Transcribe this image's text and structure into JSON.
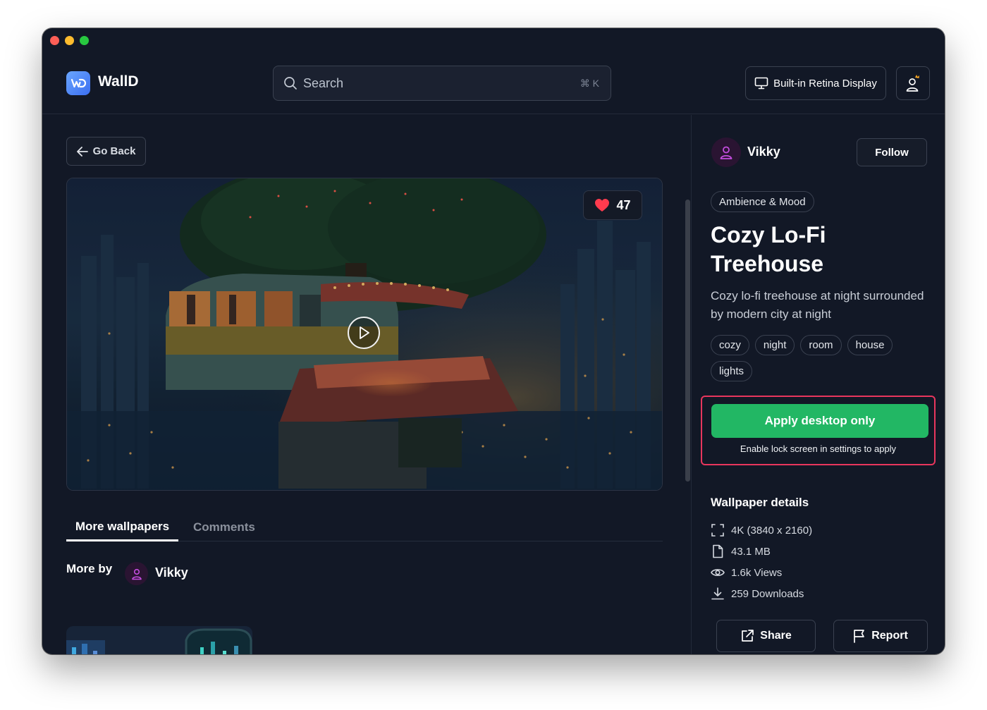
{
  "app": {
    "name": "WallD",
    "search_placeholder": "Search",
    "search_shortcut": "⌘ K",
    "display_label": "Built-in Retina Display"
  },
  "nav": {
    "go_back": "Go Back"
  },
  "wallpaper": {
    "likes": "47",
    "category": "Ambience & Mood",
    "title": "Cozy Lo-Fi Treehouse",
    "description": "Cozy lo-fi treehouse at night surrounded by modern city at night",
    "tags": [
      "cozy",
      "night",
      "room",
      "house",
      "lights"
    ]
  },
  "author": {
    "name": "Vikky",
    "follow_label": "Follow"
  },
  "tabs": {
    "more": "More wallpapers",
    "comments": "Comments"
  },
  "more_by": {
    "label": "More by",
    "name": "Vikky"
  },
  "apply": {
    "button": "Apply desktop only",
    "note": "Enable lock screen in settings to apply"
  },
  "details": {
    "title": "Wallpaper details",
    "resolution": "4K (3840 x 2160)",
    "size": "43.1 MB",
    "views": "1.6k Views",
    "downloads": "259 Downloads"
  },
  "actions": {
    "share": "Share",
    "report": "Report"
  },
  "colors": {
    "accent_green": "#22b764",
    "highlight_red": "#e8365d",
    "like_red": "#ff3b4e",
    "background": "#121826"
  }
}
